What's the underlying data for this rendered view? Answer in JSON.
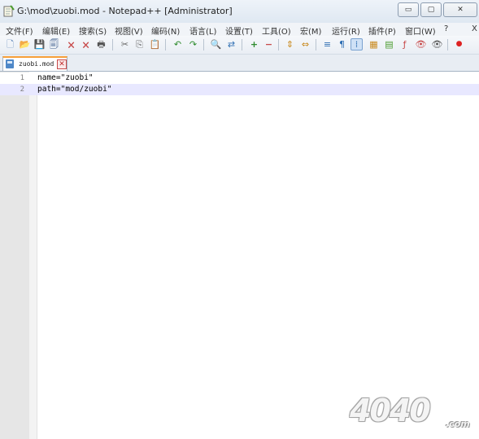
{
  "window": {
    "title": "G:\\mod\\zuobi.mod - Notepad++ [Administrator]",
    "minimize_glyph": "▭",
    "maximize_glyph": "▢",
    "close_glyph": "✕"
  },
  "menu": {
    "items": [
      "文件(F)",
      "编辑(E)",
      "搜索(S)",
      "视图(V)",
      "编码(N)",
      "语言(L)",
      "设置(T)",
      "工具(O)",
      "宏(M)",
      "运行(R)",
      "插件(P)",
      "窗口(W)",
      "?",
      "X"
    ]
  },
  "toolbar": {
    "icons": [
      "new-file-icon",
      "open-file-icon",
      "save-icon",
      "save-all-icon",
      "close-file-icon",
      "close-all-icon",
      "print-icon",
      "cut-icon",
      "copy-icon",
      "paste-icon",
      "undo-icon",
      "redo-icon",
      "find-icon",
      "replace-icon",
      "zoom-in-icon",
      "zoom-out-icon",
      "sync-vertical-icon",
      "sync-horizontal-icon",
      "word-wrap-icon",
      "show-all-chars-icon",
      "indent-guide-icon",
      "folder-as-workspace-icon",
      "doc-map-icon",
      "function-list-icon",
      "monitoring-icon",
      "record-macro-icon"
    ],
    "glyphs": [
      "🗋",
      "📂",
      "💾",
      "🗐",
      "🗙",
      "🗙",
      "🖶",
      "✂",
      "⎘",
      "📋",
      "↶",
      "↷",
      "🔍",
      "⇄",
      "+",
      "−",
      "⇕",
      "⇔",
      "≡",
      "¶",
      "⁞",
      "▦",
      "▤",
      "ƒ",
      "👁",
      "●"
    ]
  },
  "tab": {
    "label": "zuobi.mod",
    "close_glyph": "✕"
  },
  "editor": {
    "lines": [
      {
        "number": "1",
        "text": "name=\"zuobi\""
      },
      {
        "number": "2",
        "text": "path=\"mod/zuobi\""
      }
    ],
    "current_line_color": "#e8e8ff"
  },
  "watermark": {
    "text": "4040",
    "suffix": ".com"
  }
}
